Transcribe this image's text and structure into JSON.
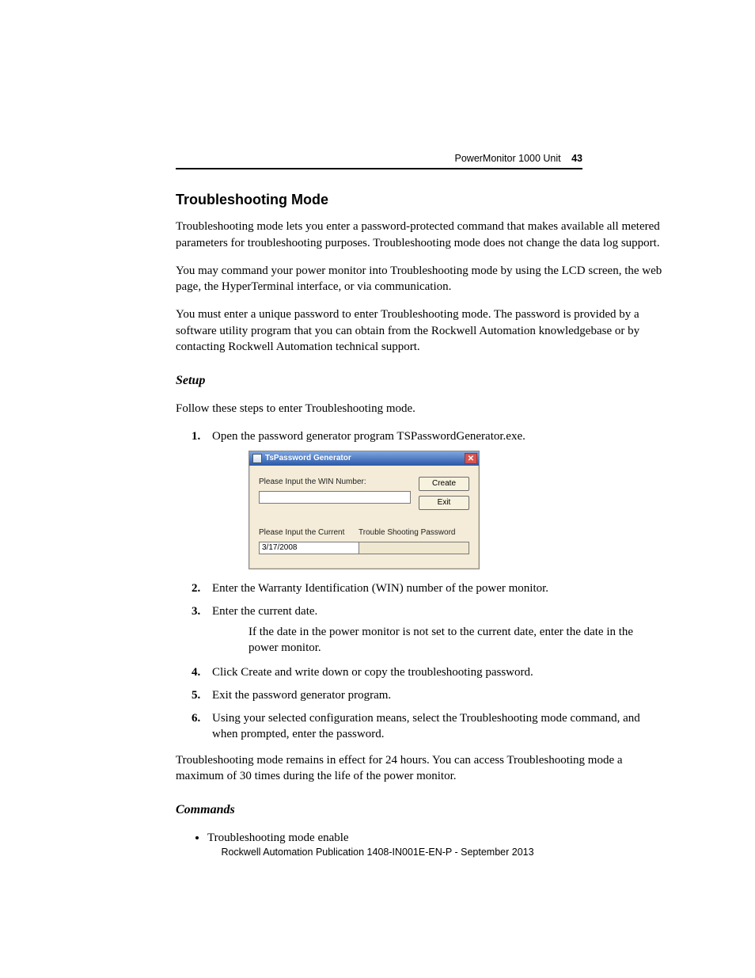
{
  "header": {
    "doc_section": "PowerMonitor 1000 Unit",
    "page_number": "43"
  },
  "section_title": "Troubleshooting Mode",
  "paragraphs": {
    "p1": "Troubleshooting mode lets you enter a password-protected command that makes available all metered parameters for troubleshooting purposes. Troubleshooting mode does not change the data log support.",
    "p2": "You may command your power monitor into Troubleshooting mode by using the LCD screen, the web page, the HyperTerminal interface, or via communication.",
    "p3": "You must enter a unique password to enter Troubleshooting mode. The password is provided by a software utility program that you can obtain from the Rockwell Automation knowledgebase or by contacting Rockwell Automation technical support."
  },
  "setup_heading": "Setup",
  "setup_intro": "Follow these steps to enter Troubleshooting mode.",
  "steps": {
    "s1": "Open the password generator program TSPasswordGenerator.exe.",
    "s2": "Enter the Warranty Identification (WIN) number of the power monitor.",
    "s3": "Enter the current date.",
    "s3_sub": "If the date in the power monitor is not set to the current date, enter the date in the power monitor.",
    "s4": "Click Create and write down or copy the troubleshooting password.",
    "s5": "Exit the password generator program.",
    "s6": "Using your selected configuration means, select the Troubleshooting mode command, and when prompted, enter the password."
  },
  "after_steps": "Troubleshooting mode remains in effect for 24 hours. You can access Troubleshooting mode a maximum of 30 times during the life of the power monitor.",
  "commands_heading": "Commands",
  "commands": {
    "c1": "Troubleshooting mode enable"
  },
  "dialog": {
    "title": "TsPassword Generator",
    "win_label": "Please Input the WIN Number:",
    "win_value": "",
    "date_label": "Please Input the Current",
    "date_value": "3/17/2008",
    "pwd_label": "Trouble Shooting Password",
    "pwd_value": "",
    "create_btn": "Create",
    "exit_btn": "Exit",
    "close_glyph": "✕",
    "dd_glyph": "▼"
  },
  "footer": "Rockwell Automation Publication 1408-IN001E-EN-P - September 2013"
}
